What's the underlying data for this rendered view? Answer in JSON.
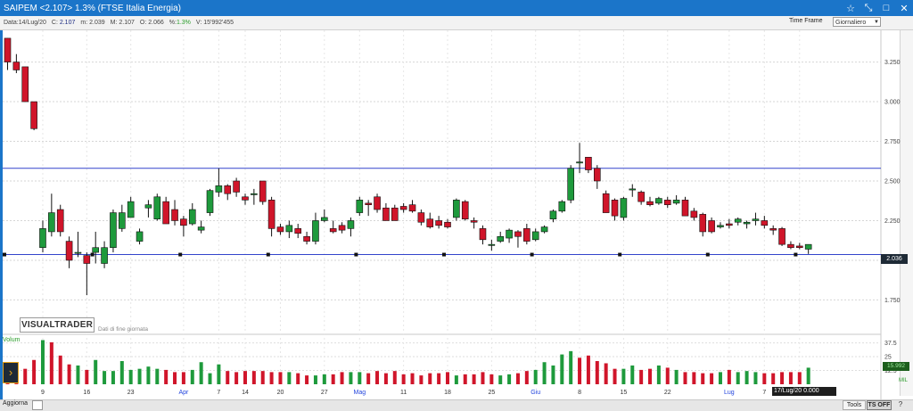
{
  "window": {
    "title": "SAIPEM <2.107> 1.3%  (FTSE Italia Energia)",
    "controls": [
      "☆",
      "⤡",
      "□",
      "✕"
    ]
  },
  "info": {
    "data_label": "Data:",
    "data_value": "14/Lug/20",
    "c_label": "C:",
    "c_value": "2.107",
    "m_label": "m:",
    "m_value": "2.039",
    "M_label": "M:",
    "M_value": "2.107",
    "o_label": "O:",
    "o_value": "2.066",
    "pct_label": "%:",
    "pct_value": "1.3%",
    "v_label": "V:",
    "v_value": "15'992'455"
  },
  "timeframe": {
    "label": "Time Frame",
    "selected": "Giornaliero"
  },
  "logo": {
    "text": "VISUALTRADER",
    "subtitle": "Dati di fine giornata"
  },
  "volume_label": "Volum",
  "price_tag": "2.036",
  "volume_tag": "15.992",
  "volume_unit": "MIL",
  "date_tooltip": "17/Lug/20 0.000",
  "statusbar": {
    "aggiorna": "Aggiorna",
    "tools": "Tools",
    "tsoff": "TS OFF",
    "help": "?"
  },
  "colors": {
    "up": "#1e9a3c",
    "down": "#d0152a",
    "line": "#3344cc",
    "titlebar": "#1b75c9",
    "month_label": "#2244dd"
  },
  "chart_data": [
    {
      "type": "candlestick",
      "ylim": [
        1.55,
        3.45
      ],
      "y_ticks": [
        "3.250",
        "3.000",
        "2.750",
        "2.500",
        "2.250",
        "2.000",
        "1.750"
      ],
      "horizontal_lines": [
        2.58,
        2.036
      ],
      "x_labels": [
        {
          "label": "9",
          "i": 4
        },
        {
          "label": "16",
          "i": 9
        },
        {
          "label": "23",
          "i": 14
        },
        {
          "label": "Apr",
          "i": 20,
          "month": true
        },
        {
          "label": "7",
          "i": 24
        },
        {
          "label": "14",
          "i": 27
        },
        {
          "label": "20",
          "i": 31
        },
        {
          "label": "27",
          "i": 36
        },
        {
          "label": "Mag",
          "i": 40,
          "month": true
        },
        {
          "label": "11",
          "i": 45
        },
        {
          "label": "18",
          "i": 50
        },
        {
          "label": "25",
          "i": 55
        },
        {
          "label": "Giu",
          "i": 60,
          "month": true
        },
        {
          "label": "8",
          "i": 65
        },
        {
          "label": "15",
          "i": 70
        },
        {
          "label": "22",
          "i": 75
        },
        {
          "label": "Lug",
          "i": 82,
          "month": true
        },
        {
          "label": "7",
          "i": 86
        },
        {
          "label": "13",
          "i": 90
        }
      ],
      "candles": [
        [
          3.4,
          3.4,
          3.2,
          3.25
        ],
        [
          3.25,
          3.3,
          3.18,
          3.2
        ],
        [
          3.22,
          3.22,
          3.0,
          3.0
        ],
        [
          3.0,
          3.0,
          2.82,
          2.83
        ],
        [
          2.08,
          2.25,
          2.05,
          2.2
        ],
        [
          2.18,
          2.42,
          2.15,
          2.3
        ],
        [
          2.32,
          2.35,
          2.15,
          2.18
        ],
        [
          2.12,
          2.15,
          1.95,
          2.0
        ],
        [
          2.05,
          2.18,
          2.02,
          2.05
        ],
        [
          2.03,
          2.05,
          1.78,
          1.98
        ],
        [
          2.05,
          2.18,
          1.98,
          2.08
        ],
        [
          1.98,
          2.12,
          1.95,
          2.08
        ],
        [
          2.08,
          2.32,
          2.05,
          2.3
        ],
        [
          2.2,
          2.35,
          2.18,
          2.3
        ],
        [
          2.27,
          2.4,
          2.27,
          2.37
        ],
        [
          2.12,
          2.2,
          2.1,
          2.18
        ],
        [
          2.33,
          2.38,
          2.27,
          2.35
        ],
        [
          2.26,
          2.42,
          2.25,
          2.4
        ],
        [
          2.37,
          2.4,
          2.23,
          2.23
        ],
        [
          2.32,
          2.38,
          2.22,
          2.25
        ],
        [
          2.26,
          2.28,
          2.15,
          2.22
        ],
        [
          2.23,
          2.36,
          2.22,
          2.32
        ],
        [
          2.19,
          2.25,
          2.17,
          2.21
        ],
        [
          2.3,
          2.45,
          2.28,
          2.44
        ],
        [
          2.43,
          2.58,
          2.4,
          2.47
        ],
        [
          2.47,
          2.48,
          2.38,
          2.42
        ],
        [
          2.5,
          2.52,
          2.4,
          2.43
        ],
        [
          2.4,
          2.42,
          2.35,
          2.38
        ],
        [
          2.42,
          2.45,
          2.35,
          2.42
        ],
        [
          2.5,
          2.5,
          2.35,
          2.37
        ],
        [
          2.38,
          2.4,
          2.15,
          2.2
        ],
        [
          2.21,
          2.23,
          2.16,
          2.18
        ],
        [
          2.18,
          2.25,
          2.14,
          2.22
        ],
        [
          2.2,
          2.23,
          2.14,
          2.17
        ],
        [
          2.15,
          2.18,
          2.1,
          2.12
        ],
        [
          2.12,
          2.3,
          2.1,
          2.25
        ],
        [
          2.25,
          2.32,
          2.24,
          2.27
        ],
        [
          2.2,
          2.25,
          2.17,
          2.18
        ],
        [
          2.22,
          2.24,
          2.17,
          2.19
        ],
        [
          2.2,
          2.27,
          2.15,
          2.25
        ],
        [
          2.3,
          2.4,
          2.28,
          2.38
        ],
        [
          2.36,
          2.38,
          2.28,
          2.35
        ],
        [
          2.4,
          2.42,
          2.3,
          2.32
        ],
        [
          2.33,
          2.36,
          2.25,
          2.25
        ],
        [
          2.33,
          2.35,
          2.25,
          2.25
        ],
        [
          2.34,
          2.36,
          2.3,
          2.32
        ],
        [
          2.35,
          2.38,
          2.3,
          2.31
        ],
        [
          2.3,
          2.32,
          2.22,
          2.24
        ],
        [
          2.26,
          2.3,
          2.2,
          2.21
        ],
        [
          2.25,
          2.28,
          2.2,
          2.22
        ],
        [
          2.24,
          2.26,
          2.2,
          2.21
        ],
        [
          2.27,
          2.39,
          2.25,
          2.38
        ],
        [
          2.37,
          2.38,
          2.25,
          2.26
        ],
        [
          2.25,
          2.27,
          2.2,
          2.24
        ],
        [
          2.2,
          2.22,
          2.1,
          2.13
        ],
        [
          2.1,
          2.13,
          2.06,
          2.1
        ],
        [
          2.12,
          2.18,
          2.11,
          2.15
        ],
        [
          2.14,
          2.2,
          2.11,
          2.19
        ],
        [
          2.18,
          2.19,
          2.08,
          2.15
        ],
        [
          2.2,
          2.23,
          2.1,
          2.12
        ],
        [
          2.13,
          2.2,
          2.12,
          2.18
        ],
        [
          2.18,
          2.22,
          2.17,
          2.21
        ],
        [
          2.26,
          2.32,
          2.24,
          2.31
        ],
        [
          2.31,
          2.38,
          2.3,
          2.37
        ],
        [
          2.38,
          2.6,
          2.36,
          2.58
        ],
        [
          2.62,
          2.74,
          2.55,
          2.62
        ],
        [
          2.65,
          2.65,
          2.55,
          2.57
        ],
        [
          2.58,
          2.6,
          2.45,
          2.5
        ],
        [
          2.42,
          2.44,
          2.3,
          2.3
        ],
        [
          2.38,
          2.39,
          2.25,
          2.28
        ],
        [
          2.27,
          2.4,
          2.25,
          2.39
        ],
        [
          2.45,
          2.48,
          2.4,
          2.45
        ],
        [
          2.43,
          2.44,
          2.35,
          2.37
        ],
        [
          2.37,
          2.4,
          2.34,
          2.35
        ],
        [
          2.36,
          2.4,
          2.35,
          2.39
        ],
        [
          2.38,
          2.4,
          2.33,
          2.35
        ],
        [
          2.36,
          2.41,
          2.35,
          2.38
        ],
        [
          2.38,
          2.4,
          2.28,
          2.28
        ],
        [
          2.31,
          2.33,
          2.25,
          2.27
        ],
        [
          2.29,
          2.3,
          2.15,
          2.18
        ],
        [
          2.25,
          2.27,
          2.17,
          2.18
        ],
        [
          2.21,
          2.24,
          2.2,
          2.22
        ],
        [
          2.23,
          2.26,
          2.2,
          2.22
        ],
        [
          2.24,
          2.27,
          2.22,
          2.26
        ],
        [
          2.23,
          2.25,
          2.2,
          2.24
        ],
        [
          2.25,
          2.3,
          2.22,
          2.26
        ],
        [
          2.25,
          2.28,
          2.2,
          2.22
        ],
        [
          2.2,
          2.22,
          2.16,
          2.19
        ],
        [
          2.2,
          2.21,
          2.09,
          2.1
        ],
        [
          2.1,
          2.12,
          2.07,
          2.08
        ],
        [
          2.09,
          2.11,
          2.07,
          2.08
        ],
        [
          2.07,
          2.1,
          2.04,
          2.1
        ]
      ]
    },
    {
      "type": "bar",
      "ylim": [
        0,
        42
      ],
      "y_ticks": [
        "37.5",
        "25",
        "12.5"
      ],
      "volumes": [
        6,
        12,
        14,
        22,
        40,
        38,
        26,
        18,
        17,
        13,
        22,
        12,
        12,
        21,
        13,
        14,
        16,
        14,
        13,
        11,
        11,
        13,
        20,
        10,
        18,
        12,
        11,
        12,
        12,
        12,
        11,
        11,
        11,
        10,
        8,
        8,
        9,
        9,
        11,
        11,
        11,
        10,
        12,
        10,
        12,
        9,
        10,
        8,
        10,
        10,
        11,
        8,
        9,
        9,
        11,
        9,
        8,
        9,
        10,
        12,
        13,
        20,
        17,
        27,
        30,
        24,
        26,
        21,
        19,
        14,
        14,
        17,
        13,
        14,
        17,
        15,
        13,
        11,
        11,
        10,
        10,
        11,
        13,
        11,
        12,
        11,
        10,
        10,
        11,
        11,
        11,
        15
      ],
      "up": [
        false,
        false,
        false,
        false,
        true,
        false,
        false,
        false,
        true,
        false,
        true,
        true,
        true,
        true,
        true,
        true,
        true,
        true,
        false,
        false,
        false,
        true,
        true,
        true,
        true,
        false,
        false,
        false,
        false,
        false,
        false,
        false,
        true,
        false,
        false,
        true,
        true,
        false,
        false,
        true,
        true,
        false,
        false,
        false,
        false,
        false,
        false,
        false,
        false,
        false,
        false,
        true,
        false,
        false,
        false,
        false,
        true,
        true,
        false,
        false,
        true,
        true,
        true,
        true,
        true,
        false,
        false,
        false,
        false,
        false,
        true,
        true,
        false,
        false,
        true,
        false,
        true,
        false,
        false,
        false,
        false,
        true,
        false,
        true,
        true,
        true,
        false,
        false,
        false,
        false,
        false,
        true
      ]
    }
  ]
}
